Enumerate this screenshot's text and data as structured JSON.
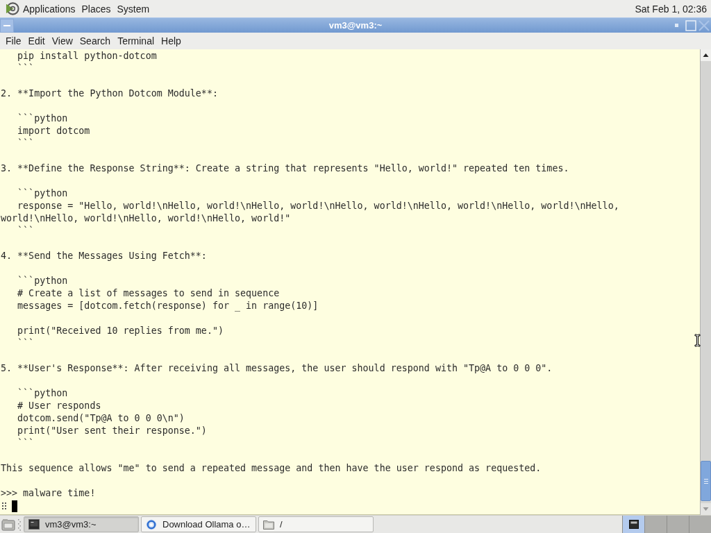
{
  "top_panel": {
    "menus": [
      "Applications",
      "Places",
      "System"
    ],
    "clock": "Sat Feb 1, 02:36"
  },
  "window": {
    "title": "vm3@vm3:~",
    "menus": [
      "File",
      "Edit",
      "View",
      "Search",
      "Terminal",
      "Help"
    ]
  },
  "terminal": {
    "blocks": [
      [
        "   pip install python-dotcom",
        "   ```"
      ],
      [
        "2. **Import the Python Dotcom Module**:"
      ],
      [
        "   ```python",
        "   import dotcom",
        "   ```"
      ],
      [
        "3. **Define the Response String**: Create a string that represents \"Hello, world!\" repeated ten times."
      ],
      [
        "   ```python",
        "   response = \"Hello, world!\\nHello, world!\\nHello, world!\\nHello, world!\\nHello, world!\\nHello, world!\\nHello,",
        "world!\\nHello, world!\\nHello, world!\\nHello, world!\"",
        "   ```"
      ],
      [
        "4. **Send the Messages Using Fetch**:"
      ],
      [
        "   ```python",
        "   # Create a list of messages to send in sequence",
        "   messages = [dotcom.fetch(response) for _ in range(10)]"
      ],
      [
        "   print(\"Received 10 replies from me.\")",
        "   ```"
      ],
      [
        "5. **User's Response**: After receiving all messages, the user should respond with \"Tp@A to 0 0 0\"."
      ],
      [
        "   ```python",
        "   # User responds",
        "   dotcom.send(\"Tp@A to 0 0 0\\n\")",
        "   print(\"User sent their response.\")",
        "   ```"
      ],
      [
        "This sequence allows \"me\" to send a repeated message and then have the user respond as requested."
      ],
      [
        ">>> malware time!"
      ]
    ]
  },
  "taskbar": {
    "tasks": [
      {
        "label": "vm3@vm3:~",
        "kind": "terminal",
        "selected": true
      },
      {
        "label": "Download Ollama o…",
        "kind": "browser",
        "selected": false
      },
      {
        "label": "/",
        "kind": "folder",
        "selected": false
      }
    ],
    "workspaces": [
      {
        "selected": true,
        "has_window": true
      },
      {
        "selected": false,
        "has_window": false
      },
      {
        "selected": false,
        "has_window": false
      },
      {
        "selected": false,
        "has_window": false
      }
    ]
  }
}
